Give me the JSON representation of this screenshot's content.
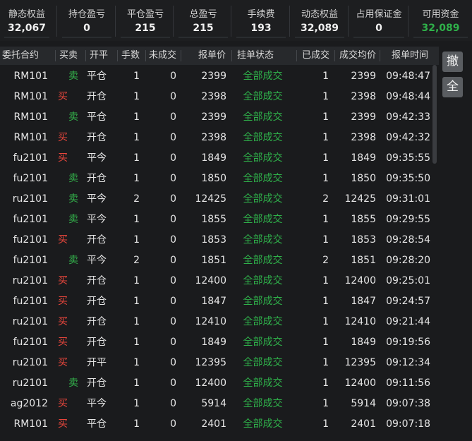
{
  "summary": [
    {
      "label": "静态权益",
      "value": "32,067"
    },
    {
      "label": "持仓盈亏",
      "value": "0"
    },
    {
      "label": "平仓盈亏",
      "value": "215"
    },
    {
      "label": "总盈亏",
      "value": "215"
    },
    {
      "label": "手续费",
      "value": "193"
    },
    {
      "label": "动态权益",
      "value": "32,089"
    },
    {
      "label": "占用保证金",
      "value": "0"
    },
    {
      "label": "可用资金",
      "value": "32,089"
    }
  ],
  "colors": {
    "buy": "#e8463c",
    "sell": "#33b04a",
    "status": "#2fb14a",
    "available": "#2fb14a"
  },
  "table": {
    "headers": [
      "委托合约",
      "买卖",
      "开平",
      "手数",
      "未成交",
      "报单价",
      "挂单状态",
      "已成交",
      "成交均价",
      "报单时间"
    ],
    "rows": [
      [
        "RM101",
        "卖",
        "平仓",
        "1",
        "0",
        "2399",
        "全部成交",
        "1",
        "2399",
        "09:48:47"
      ],
      [
        "RM101",
        "买",
        "开仓",
        "1",
        "0",
        "2398",
        "全部成交",
        "1",
        "2398",
        "09:48:44"
      ],
      [
        "RM101",
        "卖",
        "平仓",
        "1",
        "0",
        "2399",
        "全部成交",
        "1",
        "2399",
        "09:42:33"
      ],
      [
        "RM101",
        "买",
        "开仓",
        "1",
        "0",
        "2398",
        "全部成交",
        "1",
        "2398",
        "09:42:32"
      ],
      [
        "fu2101",
        "买",
        "平今",
        "1",
        "0",
        "1849",
        "全部成交",
        "1",
        "1849",
        "09:35:55"
      ],
      [
        "fu2101",
        "卖",
        "开仓",
        "1",
        "0",
        "1850",
        "全部成交",
        "1",
        "1850",
        "09:35:50"
      ],
      [
        "ru2101",
        "卖",
        "平今",
        "2",
        "0",
        "12425",
        "全部成交",
        "2",
        "12425",
        "09:31:01"
      ],
      [
        "fu2101",
        "卖",
        "平今",
        "1",
        "0",
        "1855",
        "全部成交",
        "1",
        "1855",
        "09:29:55"
      ],
      [
        "fu2101",
        "买",
        "开仓",
        "1",
        "0",
        "1853",
        "全部成交",
        "1",
        "1853",
        "09:28:54"
      ],
      [
        "fu2101",
        "卖",
        "平今",
        "2",
        "0",
        "1851",
        "全部成交",
        "2",
        "1851",
        "09:28:20"
      ],
      [
        "ru2101",
        "买",
        "开仓",
        "1",
        "0",
        "12400",
        "全部成交",
        "1",
        "12400",
        "09:25:01"
      ],
      [
        "fu2101",
        "买",
        "开仓",
        "1",
        "0",
        "1847",
        "全部成交",
        "1",
        "1847",
        "09:24:57"
      ],
      [
        "ru2101",
        "买",
        "开仓",
        "1",
        "0",
        "12410",
        "全部成交",
        "1",
        "12410",
        "09:21:44"
      ],
      [
        "fu2101",
        "买",
        "开仓",
        "1",
        "0",
        "1849",
        "全部成交",
        "1",
        "1849",
        "09:19:56"
      ],
      [
        "ru2101",
        "买",
        "开平",
        "1",
        "0",
        "12395",
        "全部成交",
        "1",
        "12395",
        "09:12:34"
      ],
      [
        "ru2101",
        "卖",
        "开仓",
        "1",
        "0",
        "12400",
        "全部成交",
        "1",
        "12400",
        "09:11:56"
      ],
      [
        "ag2012",
        "买",
        "平今",
        "1",
        "0",
        "5914",
        "全部成交",
        "1",
        "5914",
        "09:07:38"
      ],
      [
        "RM101",
        "买",
        "平仓",
        "1",
        "0",
        "2401",
        "全部成交",
        "1",
        "2401",
        "09:07:18"
      ]
    ]
  },
  "side_buttons": [
    {
      "label": "撤",
      "icon": "cancel-order-icon"
    },
    {
      "label": "全",
      "icon": "cancel-all-icon"
    }
  ]
}
